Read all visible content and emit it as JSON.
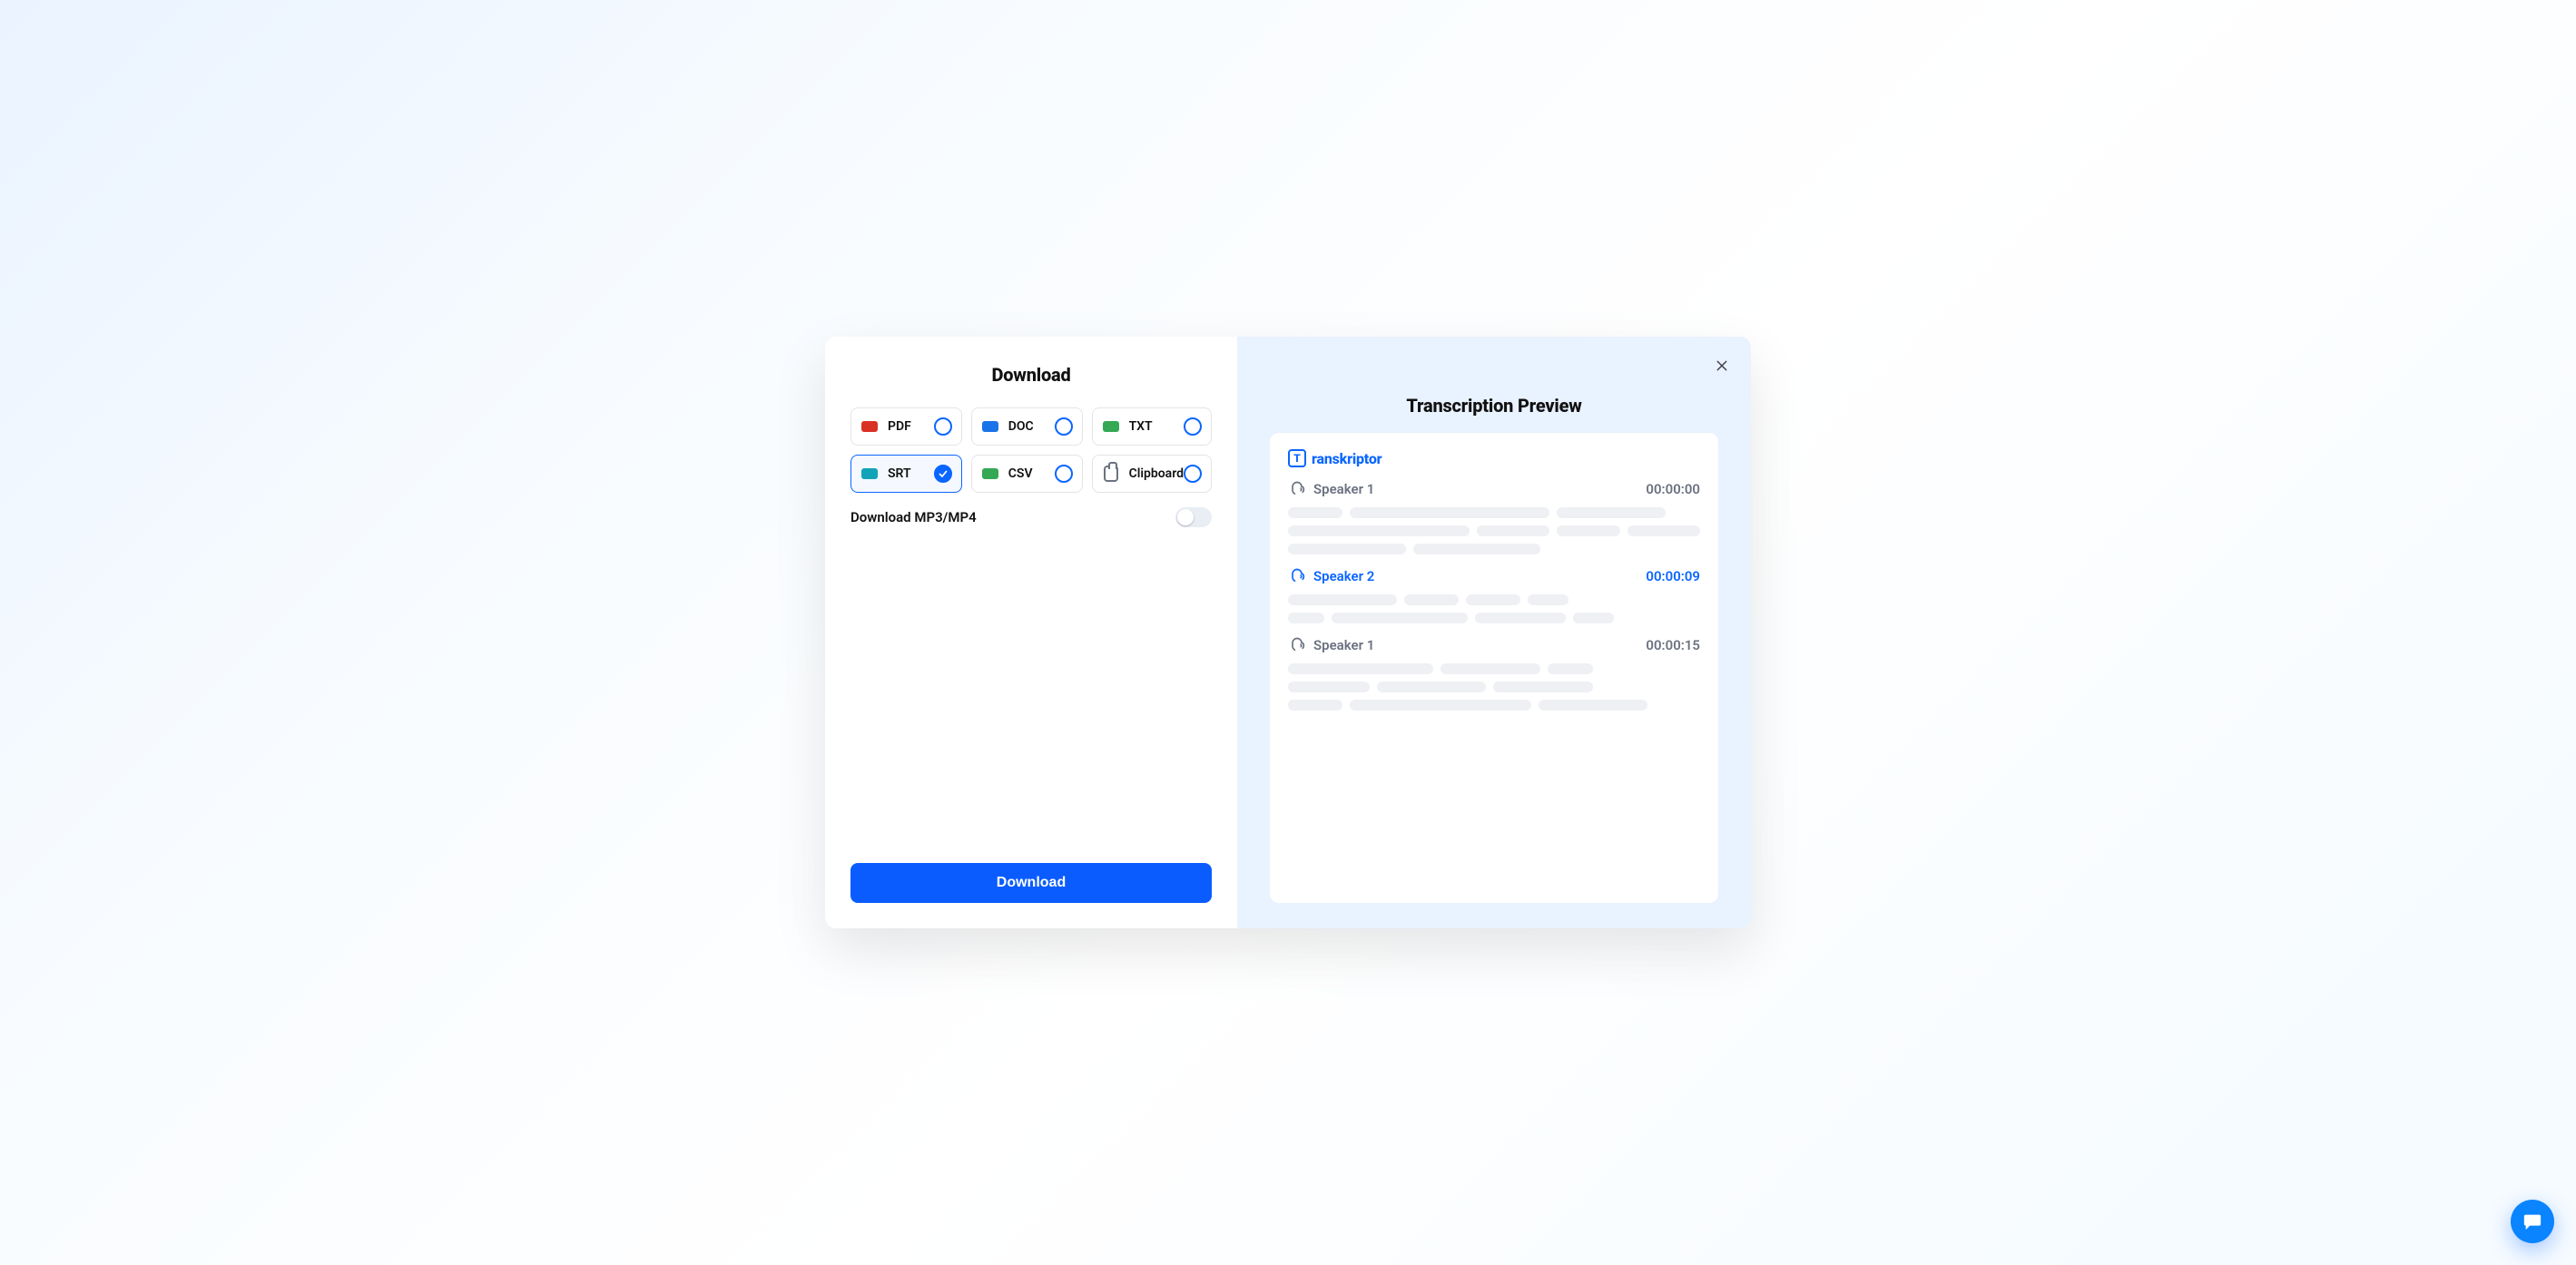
{
  "modal": {
    "title": "Download",
    "formats": [
      {
        "id": "pdf",
        "label": "PDF",
        "badgeColor": "#d93025",
        "selected": false
      },
      {
        "id": "doc",
        "label": "DOC",
        "badgeColor": "#1a73e8",
        "selected": false
      },
      {
        "id": "txt",
        "label": "TXT",
        "badgeColor": "#34a853",
        "selected": false
      },
      {
        "id": "srt",
        "label": "SRT",
        "badgeColor": "#12a3b8",
        "selected": true
      },
      {
        "id": "csv",
        "label": "CSV",
        "badgeColor": "#34a853",
        "selected": false
      },
      {
        "id": "clipboard",
        "label": "Clipboard",
        "badgeColor": "",
        "selected": false,
        "iconKind": "clipboard"
      }
    ],
    "mp3_label": "Download MP3/MP4",
    "mp3_on": false,
    "download_button": "Download"
  },
  "preview": {
    "title": "Transcription Preview",
    "brand": {
      "initial": "T",
      "rest": "ranskriptor"
    },
    "segments": [
      {
        "style": "gray",
        "speaker": "Speaker 1",
        "time": "00:00:00",
        "rows": [
          [
            60,
            220,
            120
          ],
          [
            200,
            80,
            70,
            80
          ],
          [
            130,
            140
          ]
        ]
      },
      {
        "style": "blue",
        "speaker": "Speaker 2",
        "time": "00:00:09",
        "rows": [
          [
            120,
            60,
            60,
            45
          ],
          [
            40,
            150,
            100,
            45
          ]
        ]
      },
      {
        "style": "gray",
        "speaker": "Speaker 1",
        "time": "00:00:15",
        "rows": [
          [
            160,
            110,
            50
          ],
          [
            90,
            120,
            110
          ],
          [
            60,
            200,
            120
          ]
        ]
      }
    ]
  },
  "icons": {
    "close": "✕"
  }
}
